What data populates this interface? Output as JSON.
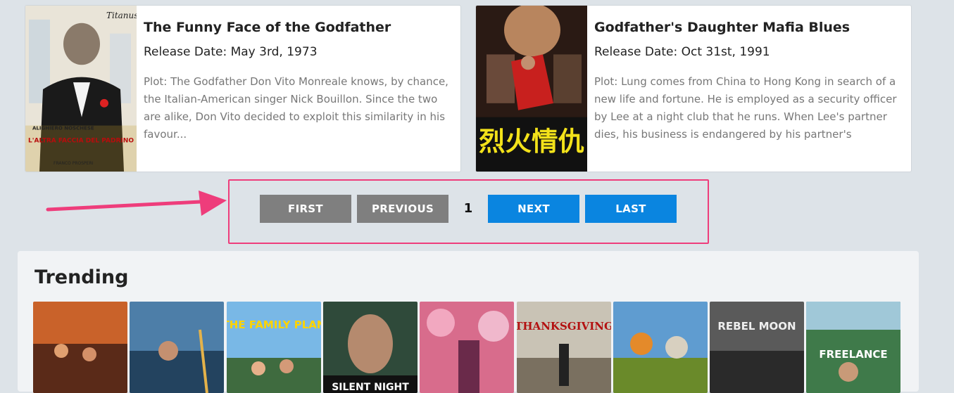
{
  "movies": [
    {
      "title": "The Funny Face of the Godfather",
      "release_date": "Release Date: May 3rd, 1973",
      "plot": "Plot: The Godfather Don Vito Monreale knows, by chance, the Italian-American singer Nick Bouillon. Since the two are alike, Don Vito decided to exploit this similarity in his favour...",
      "poster_text_top": "Titanus",
      "poster_text_name": "ALIGHIERO NOSCHESE",
      "poster_text_bottom": "L'ALTRA FACCIA DEL PADRINO",
      "poster_text_credit": "FRANCO PROSPERI"
    },
    {
      "title": "Godfather's Daughter Mafia Blues",
      "release_date": "Release Date: Oct 31st, 1991",
      "plot": "Plot: Lung comes from China to Hong Kong in search of a new life and fortune. He is employed as a security officer by Lee at a night club that he runs. When Lee's partner dies, his business is endangered by his partner's",
      "poster_text_chinese": "烈火情仇"
    }
  ],
  "pagination": {
    "first_label": "FIRST",
    "previous_label": "PREVIOUS",
    "current_page": "1",
    "next_label": "NEXT",
    "last_label": "LAST"
  },
  "trending": {
    "title": "Trending",
    "items": [
      {
        "label": ""
      },
      {
        "label": ""
      },
      {
        "label": "THE FAMILY PLAN"
      },
      {
        "label": "SILENT NIGHT"
      },
      {
        "label": ""
      },
      {
        "label": "THANKSGIVING"
      },
      {
        "label": ""
      },
      {
        "label": "REBEL MOON"
      },
      {
        "label": "FREELANCE"
      }
    ]
  },
  "colors": {
    "background": "#dde3e8",
    "button_gray": "#7f7f7f",
    "button_blue": "#0a85e0",
    "highlight": "#ee3d7b"
  }
}
